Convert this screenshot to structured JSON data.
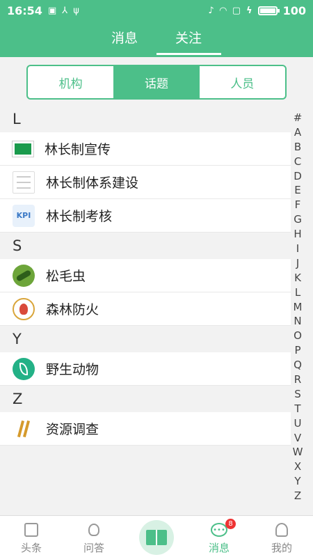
{
  "status": {
    "time": "16:54",
    "battery": "100",
    "battery_level": 1.0
  },
  "header": {
    "tabs": [
      {
        "label": "消息"
      },
      {
        "label": "关注"
      }
    ],
    "active_tab": "关注"
  },
  "segments": [
    {
      "label": "机构"
    },
    {
      "label": "话题"
    },
    {
      "label": "人员"
    }
  ],
  "active_segment": "话题",
  "sections": [
    {
      "letter": "L",
      "items": [
        {
          "label": "林长制宣传",
          "icon": "green-board-icon"
        },
        {
          "label": "林长制体系建设",
          "icon": "document-icon"
        },
        {
          "label": "林长制考核",
          "icon": "kpi-icon"
        }
      ]
    },
    {
      "letter": "S",
      "items": [
        {
          "label": "松毛虫",
          "icon": "caterpillar-icon"
        },
        {
          "label": "森林防火",
          "icon": "fire-emblem-icon"
        }
      ]
    },
    {
      "letter": "Y",
      "items": [
        {
          "label": "野生动物",
          "icon": "leaf-icon"
        }
      ]
    },
    {
      "letter": "Z",
      "items": [
        {
          "label": "资源调查",
          "icon": "survey-icon"
        }
      ]
    }
  ],
  "index_letters": [
    "#",
    "A",
    "B",
    "C",
    "D",
    "E",
    "F",
    "G",
    "H",
    "I",
    "J",
    "K",
    "L",
    "M",
    "N",
    "O",
    "P",
    "Q",
    "R",
    "S",
    "T",
    "U",
    "V",
    "W",
    "X",
    "Y",
    "Z"
  ],
  "bottom_nav": {
    "items": [
      {
        "label": "头条"
      },
      {
        "label": "问答"
      },
      {
        "label": "消息",
        "badge": "8"
      },
      {
        "label": "我的"
      }
    ],
    "accent": "#4cbf89"
  },
  "colors": {
    "primary": "#4cbf89",
    "badge": "#ee3333"
  }
}
